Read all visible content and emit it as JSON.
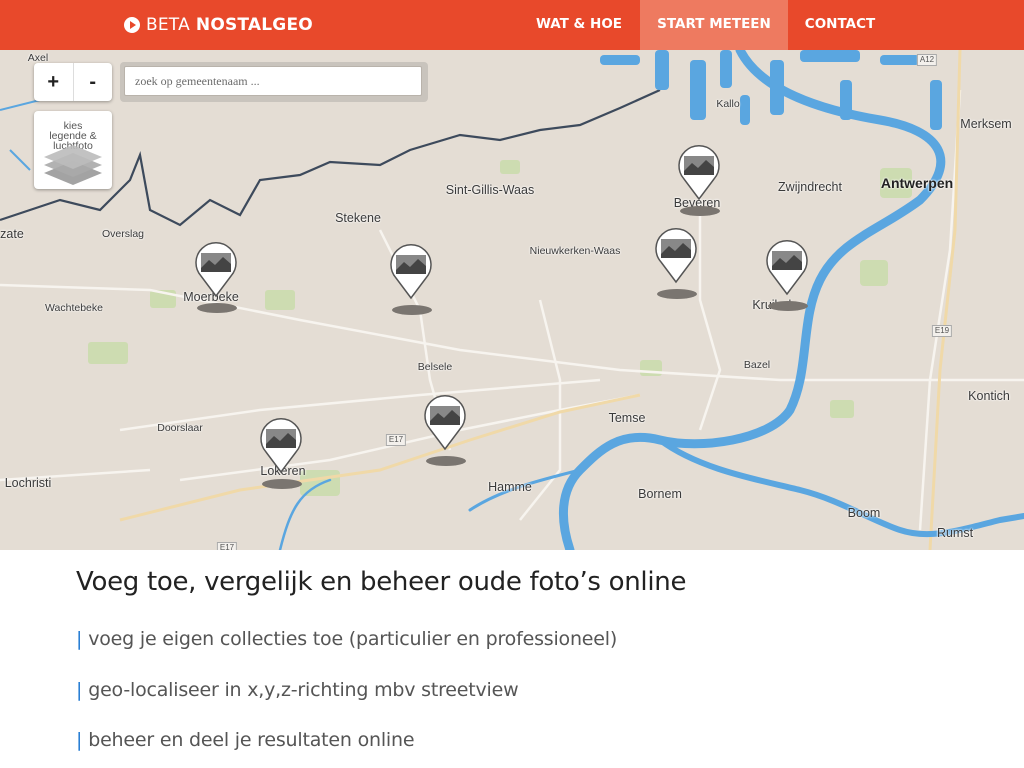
{
  "nav": {
    "brand_prefix": "BETA",
    "brand_name": "NOSTALGEO",
    "items": [
      {
        "label": "WAT & HOE"
      },
      {
        "label": "START METEEN"
      },
      {
        "label": "CONTACT"
      }
    ]
  },
  "map": {
    "zoom_in": "+",
    "zoom_out": "-",
    "search_placeholder": "zoek op gemeentenaam ...",
    "layers_label": "kies\nlegende &\nluchtfoto",
    "places": {
      "antwerpen": "Antwerpen",
      "merksem": "Merksem",
      "kallo": "Kallo",
      "zwijndrecht": "Zwijndrecht",
      "beveren": "Beveren",
      "sint_gillis": "Sint-Gillis-Waas",
      "stekene": "Stekene",
      "nieuwkerken": "Nieuwkerken-Waas",
      "moerbeke": "Moerbeke",
      "wachtebeke": "Wachtebeke",
      "overslag": "Overslag",
      "zate": "zate",
      "kruibeke": "Kruibeke",
      "bazel": "Bazel",
      "belsele": "Belsele",
      "temse": "Temse",
      "doorslaar": "Doorslaar",
      "lokeren": "Lokeren",
      "lochristi": "Lochristi",
      "hamme": "Hamme",
      "bornem": "Bornem",
      "boom": "Boom",
      "rumst": "Rumst",
      "kontich": "Kontich",
      "axel": "Axel"
    },
    "highways": {
      "a12": "A12",
      "e19": "E19",
      "e17": "E17",
      "e17b": "E17"
    }
  },
  "content": {
    "headline": "Voeg toe, vergelijk en beheer oude foto’s online",
    "bullet_marker": "|",
    "bullets": [
      "voeg je eigen collecties toe (particulier en professioneel)",
      "geo-localiseer in x,y,z-richting mbv streetview",
      "beheer en deel je resultaten online"
    ]
  },
  "colors": {
    "nav_bg": "#e8492b",
    "nav_active": "#ee7a60",
    "water": "#5aa6e0",
    "land": "#e4ddd4",
    "bullet_bar": "#2a7fd4"
  }
}
